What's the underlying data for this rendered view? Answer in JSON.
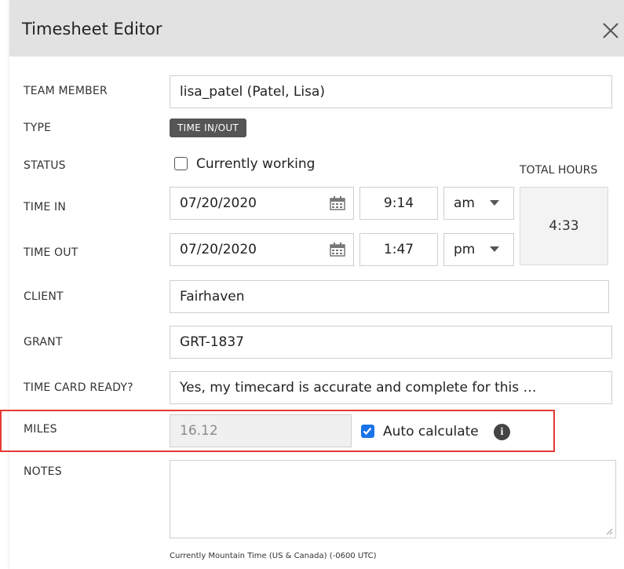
{
  "dialog": {
    "title": "Timesheet Editor"
  },
  "fields": {
    "team_member": {
      "label": "TEAM MEMBER",
      "value": "lisa_patel (Patel, Lisa)"
    },
    "type": {
      "label": "TYPE",
      "value": "TIME IN/OUT"
    },
    "status": {
      "label": "STATUS",
      "checkbox_label": "Currently working",
      "checked": false
    },
    "total_hours": {
      "label": "TOTAL HOURS",
      "value": "4:33"
    },
    "time_in": {
      "label": "TIME IN",
      "date": "07/20/2020",
      "time": "9:14",
      "ampm": "am"
    },
    "time_out": {
      "label": "TIME OUT",
      "date": "07/20/2020",
      "time": "1:47",
      "ampm": "pm"
    },
    "client": {
      "label": "CLIENT",
      "value": "Fairhaven"
    },
    "grant": {
      "label": "GRANT",
      "value": "GRT-1837"
    },
    "time_card_ready": {
      "label": "TIME CARD READY?",
      "value": "Yes, my timecard is accurate and complete for this …"
    },
    "miles": {
      "label": "MILES",
      "value": "16.12",
      "auto_label": "Auto calculate",
      "auto_checked": true
    },
    "notes": {
      "label": "NOTES",
      "value": ""
    }
  },
  "timezone_note": "Currently Mountain Time (US & Canada) (-0600 UTC)",
  "icons": {
    "close": "close-icon",
    "calendar": "calendar-icon",
    "info": "info-icon",
    "dropdown": "chevron-down-icon"
  },
  "colors": {
    "header_bg": "#e2e2e2",
    "badge_bg": "#555555",
    "checkbox_checked": "#1a73e8",
    "highlight": "#e53935"
  }
}
